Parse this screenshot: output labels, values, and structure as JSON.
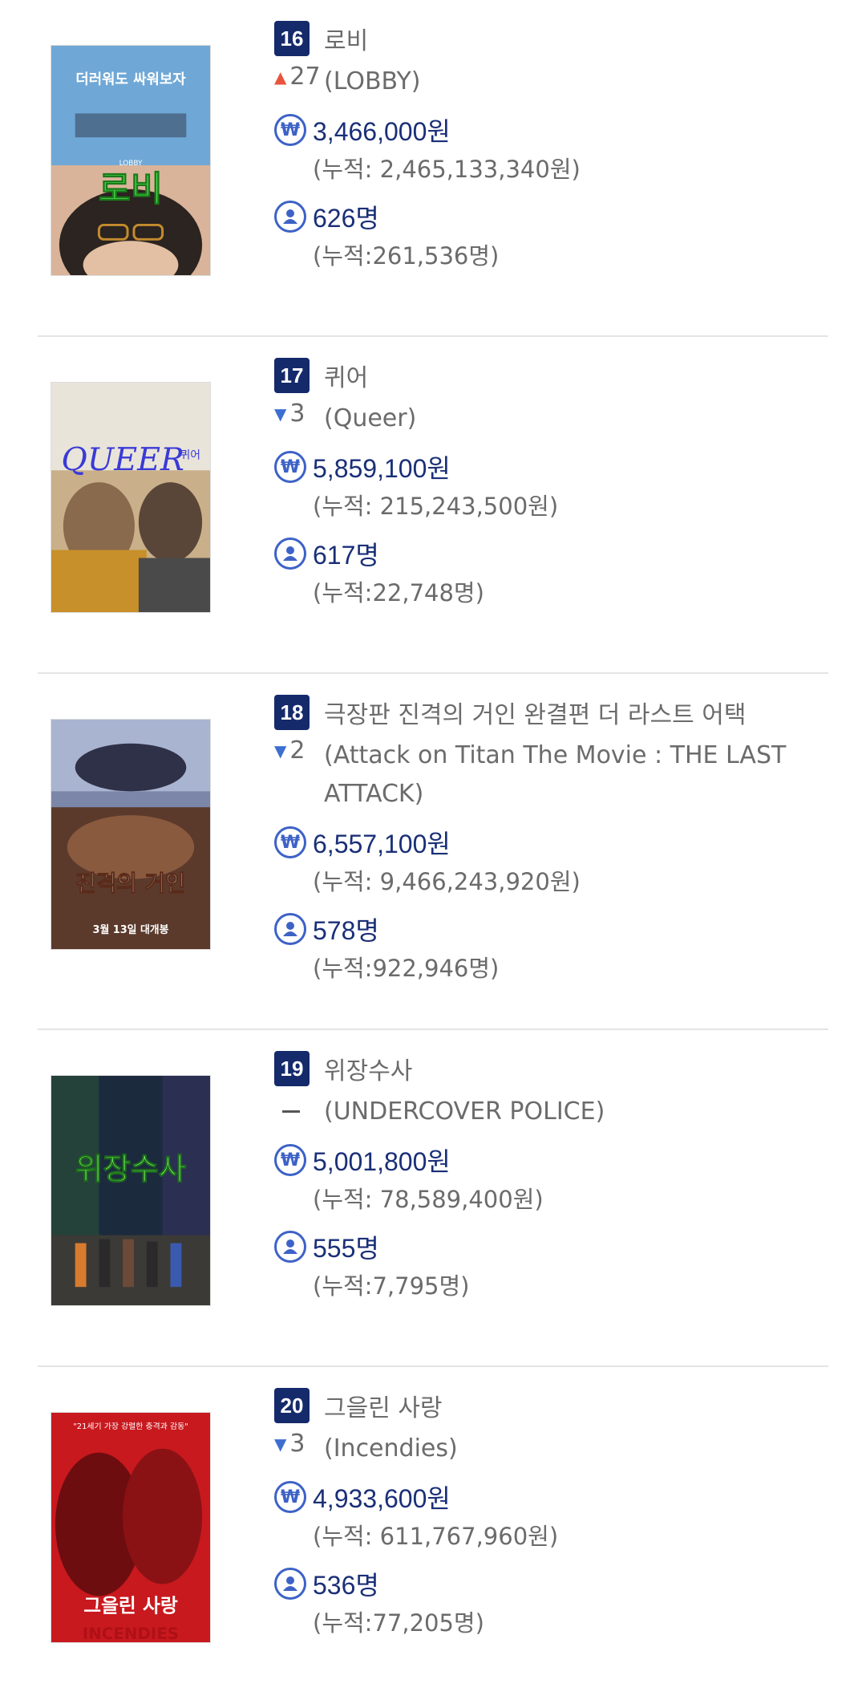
{
  "entries": [
    {
      "rank": "16",
      "title": "로비",
      "change": "27",
      "change_dir": "up",
      "en_title": "(LOBBY)",
      "sales": "3,466,000원",
      "sales_cum": "(누적: 2,465,133,340원)",
      "audience": "626명",
      "audience_cum": "(누적:261,536명)",
      "poster_icon": "lobby-poster-image"
    },
    {
      "rank": "17",
      "title": "퀴어",
      "change": "3",
      "change_dir": "down",
      "en_title": "(Queer)",
      "sales": "5,859,100원",
      "sales_cum": "(누적: 215,243,500원)",
      "audience": "617명",
      "audience_cum": "(누적:22,748명)",
      "poster_icon": "queer-poster-image"
    },
    {
      "rank": "18",
      "title": "극장판 진격의 거인 완결편 더 라스트 어택",
      "change": "2",
      "change_dir": "down",
      "en_title": "(Attack on Titan The Movie : THE LAST ATTACK)",
      "sales": "6,557,100원",
      "sales_cum": "(누적: 9,466,243,920원)",
      "audience": "578명",
      "audience_cum": "(누적:922,946명)",
      "poster_icon": "attack-on-titan-poster-image"
    },
    {
      "rank": "19",
      "title": "위장수사",
      "change": "",
      "change_dir": "none",
      "en_title": "(UNDERCOVER POLICE)",
      "sales": "5,001,800원",
      "sales_cum": "(누적: 78,589,400원)",
      "audience": "555명",
      "audience_cum": "(누적:7,795명)",
      "poster_icon": "undercover-police-poster-image"
    },
    {
      "rank": "20",
      "title": "그을린 사랑",
      "change": "3",
      "change_dir": "down",
      "en_title": "(Incendies)",
      "sales": "4,933,600원",
      "sales_cum": "(누적: 611,767,960원)",
      "audience": "536명",
      "audience_cum": "(누적:77,205명)",
      "poster_icon": "incendies-poster-image"
    }
  ],
  "poster_text": {
    "lobby_top": "더러워도 싸워보자",
    "lobby_main": "로비",
    "lobby_small": "LOBBY",
    "queer_main": "QUEER",
    "queer_kr": "퀴어",
    "titan_main": "진격의 거인",
    "titan_date": "3월 13일 대개봉",
    "undercover_main": "위장수사",
    "incendies_quote": "\"21세기 가장 강렬한 충격과 감동\"",
    "incendies_main": "그을린 사랑",
    "incendies_en": "INCENDIES"
  },
  "icons": {
    "sales": "won-icon",
    "audience": "person-icon"
  },
  "colors": {
    "rank_bg": "#152a6b",
    "value_text": "#1a2f77",
    "icon": "#3d62c7",
    "up_arrow": "#e8553d",
    "down_arrow": "#3d6fd1"
  }
}
